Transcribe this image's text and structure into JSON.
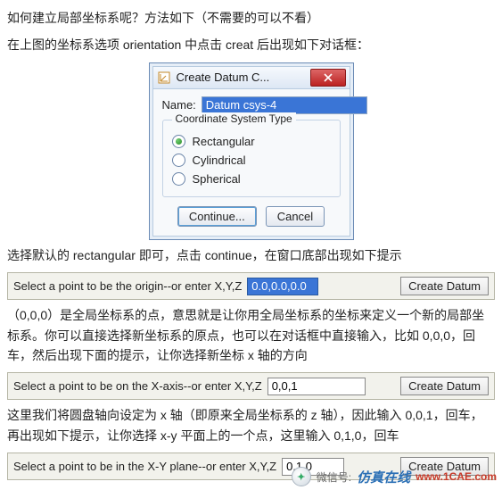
{
  "para1": "如何建立局部坐标系呢？方法如下（不需要的可以不看）",
  "para2": "在上图的坐标系选项 orientation 中点击 creat 后出现如下对话框：",
  "dialog": {
    "title": "Create Datum C...",
    "name_label": "Name:",
    "name_value": "Datum csys-4",
    "group_legend": "Coordinate System Type",
    "radios": {
      "rect": "Rectangular",
      "cyl": "Cylindrical",
      "sph": "Spherical"
    },
    "continue_btn": "Continue...",
    "cancel_btn": "Cancel"
  },
  "para3": "选择默认的 rectangular 即可，点击 continue，在窗口底部出现如下提示",
  "prompt1": {
    "text": "Select a point to be the origin--or enter X,Y,Z",
    "value": "0.0,0.0,0.0",
    "btn": "Create Datum"
  },
  "para4": "（0,0,0）是全局坐标系的点，意思就是让你用全局坐标系的坐标来定义一个新的局部坐标系。你可以直接选择新坐标系的原点，也可以在对话框中直接输入，比如 0,0,0，回车，然后出现下面的提示，让你选择新坐标 x 轴的方向",
  "prompt2": {
    "text": "Select a point to be on the X-axis--or enter X,Y,Z",
    "value": "0,0,1",
    "btn": "Create Datum"
  },
  "para5": "这里我们将圆盘轴向设定为 x 轴（即原来全局坐标系的 z 轴），因此输入 0,0,1，回车，再出现如下提示，让你选择 x-y 平面上的一个点，这里输入 0,1,0，回车",
  "prompt3": {
    "text": "Select a point to be in the X-Y plane--or enter X,Y,Z",
    "value": "0,1,0",
    "btn": "Create Datum"
  },
  "watermark": {
    "wxlabel": "微信号:",
    "wxname": "仿真在线",
    "site": "www.1CAE.com"
  }
}
